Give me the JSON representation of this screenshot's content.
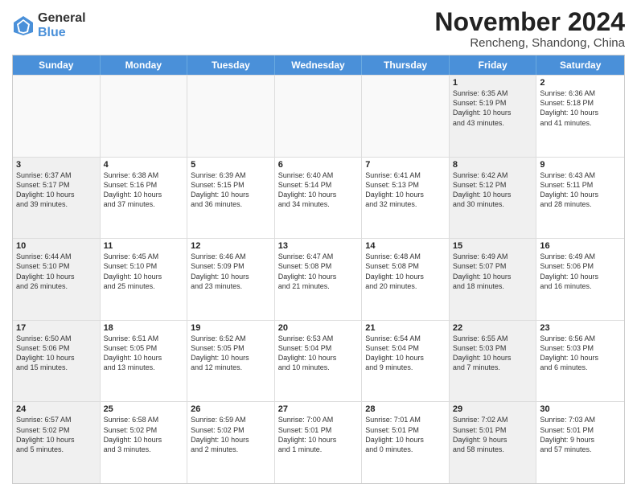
{
  "logo": {
    "general": "General",
    "blue": "Blue"
  },
  "title": "November 2024",
  "location": "Rencheng, Shandong, China",
  "header_days": [
    "Sunday",
    "Monday",
    "Tuesday",
    "Wednesday",
    "Thursday",
    "Friday",
    "Saturday"
  ],
  "rows": [
    [
      {
        "day": "",
        "text": "",
        "empty": true
      },
      {
        "day": "",
        "text": "",
        "empty": true
      },
      {
        "day": "",
        "text": "",
        "empty": true
      },
      {
        "day": "",
        "text": "",
        "empty": true
      },
      {
        "day": "",
        "text": "",
        "empty": true
      },
      {
        "day": "1",
        "text": "Sunrise: 6:35 AM\nSunset: 5:19 PM\nDaylight: 10 hours\nand 43 minutes.",
        "shaded": true
      },
      {
        "day": "2",
        "text": "Sunrise: 6:36 AM\nSunset: 5:18 PM\nDaylight: 10 hours\nand 41 minutes.",
        "shaded": false
      }
    ],
    [
      {
        "day": "3",
        "text": "Sunrise: 6:37 AM\nSunset: 5:17 PM\nDaylight: 10 hours\nand 39 minutes.",
        "shaded": true
      },
      {
        "day": "4",
        "text": "Sunrise: 6:38 AM\nSunset: 5:16 PM\nDaylight: 10 hours\nand 37 minutes.",
        "shaded": false
      },
      {
        "day": "5",
        "text": "Sunrise: 6:39 AM\nSunset: 5:15 PM\nDaylight: 10 hours\nand 36 minutes.",
        "shaded": false
      },
      {
        "day": "6",
        "text": "Sunrise: 6:40 AM\nSunset: 5:14 PM\nDaylight: 10 hours\nand 34 minutes.",
        "shaded": false
      },
      {
        "day": "7",
        "text": "Sunrise: 6:41 AM\nSunset: 5:13 PM\nDaylight: 10 hours\nand 32 minutes.",
        "shaded": false
      },
      {
        "day": "8",
        "text": "Sunrise: 6:42 AM\nSunset: 5:12 PM\nDaylight: 10 hours\nand 30 minutes.",
        "shaded": true
      },
      {
        "day": "9",
        "text": "Sunrise: 6:43 AM\nSunset: 5:11 PM\nDaylight: 10 hours\nand 28 minutes.",
        "shaded": false
      }
    ],
    [
      {
        "day": "10",
        "text": "Sunrise: 6:44 AM\nSunset: 5:10 PM\nDaylight: 10 hours\nand 26 minutes.",
        "shaded": true
      },
      {
        "day": "11",
        "text": "Sunrise: 6:45 AM\nSunset: 5:10 PM\nDaylight: 10 hours\nand 25 minutes.",
        "shaded": false
      },
      {
        "day": "12",
        "text": "Sunrise: 6:46 AM\nSunset: 5:09 PM\nDaylight: 10 hours\nand 23 minutes.",
        "shaded": false
      },
      {
        "day": "13",
        "text": "Sunrise: 6:47 AM\nSunset: 5:08 PM\nDaylight: 10 hours\nand 21 minutes.",
        "shaded": false
      },
      {
        "day": "14",
        "text": "Sunrise: 6:48 AM\nSunset: 5:08 PM\nDaylight: 10 hours\nand 20 minutes.",
        "shaded": false
      },
      {
        "day": "15",
        "text": "Sunrise: 6:49 AM\nSunset: 5:07 PM\nDaylight: 10 hours\nand 18 minutes.",
        "shaded": true
      },
      {
        "day": "16",
        "text": "Sunrise: 6:49 AM\nSunset: 5:06 PM\nDaylight: 10 hours\nand 16 minutes.",
        "shaded": false
      }
    ],
    [
      {
        "day": "17",
        "text": "Sunrise: 6:50 AM\nSunset: 5:06 PM\nDaylight: 10 hours\nand 15 minutes.",
        "shaded": true
      },
      {
        "day": "18",
        "text": "Sunrise: 6:51 AM\nSunset: 5:05 PM\nDaylight: 10 hours\nand 13 minutes.",
        "shaded": false
      },
      {
        "day": "19",
        "text": "Sunrise: 6:52 AM\nSunset: 5:05 PM\nDaylight: 10 hours\nand 12 minutes.",
        "shaded": false
      },
      {
        "day": "20",
        "text": "Sunrise: 6:53 AM\nSunset: 5:04 PM\nDaylight: 10 hours\nand 10 minutes.",
        "shaded": false
      },
      {
        "day": "21",
        "text": "Sunrise: 6:54 AM\nSunset: 5:04 PM\nDaylight: 10 hours\nand 9 minutes.",
        "shaded": false
      },
      {
        "day": "22",
        "text": "Sunrise: 6:55 AM\nSunset: 5:03 PM\nDaylight: 10 hours\nand 7 minutes.",
        "shaded": true
      },
      {
        "day": "23",
        "text": "Sunrise: 6:56 AM\nSunset: 5:03 PM\nDaylight: 10 hours\nand 6 minutes.",
        "shaded": false
      }
    ],
    [
      {
        "day": "24",
        "text": "Sunrise: 6:57 AM\nSunset: 5:02 PM\nDaylight: 10 hours\nand 5 minutes.",
        "shaded": true
      },
      {
        "day": "25",
        "text": "Sunrise: 6:58 AM\nSunset: 5:02 PM\nDaylight: 10 hours\nand 3 minutes.",
        "shaded": false
      },
      {
        "day": "26",
        "text": "Sunrise: 6:59 AM\nSunset: 5:02 PM\nDaylight: 10 hours\nand 2 minutes.",
        "shaded": false
      },
      {
        "day": "27",
        "text": "Sunrise: 7:00 AM\nSunset: 5:01 PM\nDaylight: 10 hours\nand 1 minute.",
        "shaded": false
      },
      {
        "day": "28",
        "text": "Sunrise: 7:01 AM\nSunset: 5:01 PM\nDaylight: 10 hours\nand 0 minutes.",
        "shaded": false
      },
      {
        "day": "29",
        "text": "Sunrise: 7:02 AM\nSunset: 5:01 PM\nDaylight: 9 hours\nand 58 minutes.",
        "shaded": true
      },
      {
        "day": "30",
        "text": "Sunrise: 7:03 AM\nSunset: 5:01 PM\nDaylight: 9 hours\nand 57 minutes.",
        "shaded": false
      }
    ]
  ]
}
